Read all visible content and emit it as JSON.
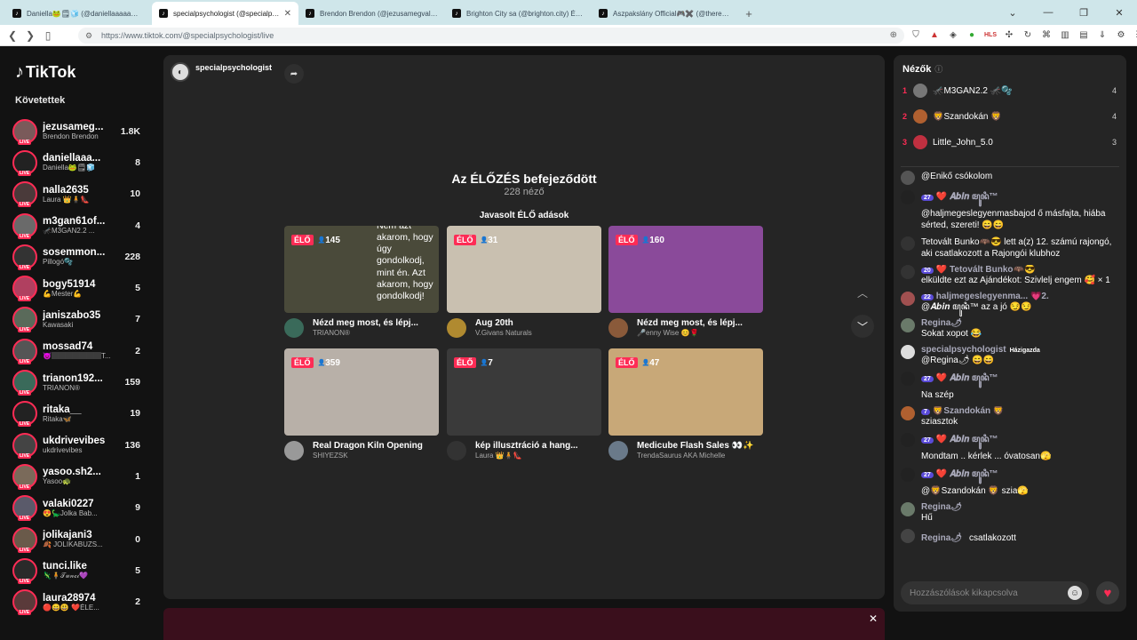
{
  "browser": {
    "tabs": [
      {
        "title": "Daniella🐸🗒🧊 (@daniellaaaaa…"
      },
      {
        "title": "specialpsychologist (@specialps…"
      },
      {
        "title": "Brendon Brendon (@jezusamegvalt…"
      },
      {
        "title": "Brighton City sa (@brighton.city) ÉLŐ"
      },
      {
        "title": "Aszpakslány Official🎮✖️ (@theresi…"
      }
    ],
    "url": "https://www.tiktok.com/@specialpsychologist/live",
    "new_tab": "+"
  },
  "sidebar": {
    "logo": "TikTok",
    "following_label": "Követettek",
    "live_tag": "LIVE",
    "items": [
      {
        "user": "jezusameg...",
        "display": "Brendon Brendon",
        "count": "1.8K",
        "color": "#7a5a5a"
      },
      {
        "user": "daniellaaa...",
        "display": "Daniella🐸🗒🧊",
        "count": "8",
        "color": "#222"
      },
      {
        "user": "nalla2635",
        "display": "Laura 👑🧍👠",
        "count": "10",
        "color": "#4a3a3a"
      },
      {
        "user": "m3gan61of...",
        "display": "🦟M3GAN2.2 ...",
        "count": "4",
        "color": "#6a6a6a"
      },
      {
        "user": "sosemmon...",
        "display": "Pillogó🫧",
        "count": "228",
        "color": "#333"
      },
      {
        "user": "bogy51914",
        "display": "💪Mester💪",
        "count": "5",
        "color": "#b04060"
      },
      {
        "user": "janiszabo35",
        "display": "Kawasaki",
        "count": "7",
        "color": "#5a6a5a"
      },
      {
        "user": "mossad74",
        "display": "😈🏽🏽🏽🏽🏽🏽🏽T...",
        "count": "2",
        "color": "#555"
      },
      {
        "user": "trianon192...",
        "display": "TRIANON®",
        "count": "159",
        "color": "#3a6a5a"
      },
      {
        "user": "ritaka__",
        "display": "Ritaka🦋",
        "count": "19",
        "color": "#222"
      },
      {
        "user": "ukdrivevibes",
        "display": "ukdrivevibes",
        "count": "136",
        "color": "#444"
      },
      {
        "user": "yasoo.sh2...",
        "display": "Yasoo🐢",
        "count": "1",
        "color": "#7a6a5a"
      },
      {
        "user": "valaki0227",
        "display": "😍🦕Jolka Bab...",
        "count": "9",
        "color": "#5a5a6a"
      },
      {
        "user": "jolikajani3",
        "display": "🍂 JOLIKABUZS...",
        "count": "0",
        "color": "#6a5a4a"
      },
      {
        "user": "tunci.like",
        "display": "🦎🧍𝒯𝓊𝓃𝒸𝒾💜",
        "count": "5",
        "color": "#2a2a2a"
      },
      {
        "user": "laura28974",
        "display": "🔴😄😃 ❤️ÉLE...",
        "count": "2",
        "color": "#5a3a3a"
      }
    ]
  },
  "main": {
    "host": "specialpsychologist",
    "ended_title": "Az ÉLŐZÉS befejeződött",
    "viewers": "228 néző",
    "suggested_label": "Javasolt ÉLŐ adások",
    "live_badge": "ÉLŐ",
    "cards": [
      {
        "viewers": "145",
        "title": "Nézd meg most, és lépj...",
        "sub": "TRIANON®",
        "bg": "#4a4a3a",
        "thumb_text": "Nem azt akarom, hogy úgy gondolkodj, mint én. Azt akarom, hogy gondolkodj!"
      },
      {
        "viewers": "31",
        "title": "Aug 20th",
        "sub": "V.Givans Naturals",
        "bg": "#c9c0b0",
        "thumb_text": ""
      },
      {
        "viewers": "160",
        "title": "Nézd meg most, és lépj...",
        "sub": "🎤enny Wise 😊🌹",
        "bg": "#8a4a9a",
        "thumb_text": ""
      },
      {
        "viewers": "359",
        "title": "Real Dragon Kiln Opening",
        "sub": "SHIYEZSK",
        "bg": "#b8b0a8",
        "thumb_text": ""
      },
      {
        "viewers": "7",
        "title": "kép illusztráció a hang...",
        "sub": "Laura 👑🧍👠",
        "bg": "#3a3a3a",
        "thumb_text": ""
      },
      {
        "viewers": "47",
        "title": "Medicube Flash Sales 👀✨",
        "sub": "TrendaSaurus AKA Michelle",
        "bg": "#c8a878",
        "thumb_text": ""
      }
    ]
  },
  "chat": {
    "title": "Nézők",
    "ranking": [
      {
        "rank": "1",
        "name": "🦟M3GAN2.2 🦟🫧",
        "score": "4",
        "color": "#777"
      },
      {
        "rank": "2",
        "name": "🦁Szandokán 🦁",
        "score": "4",
        "color": "#b06030"
      },
      {
        "rank": "3",
        "name": "Little_John_5.0",
        "score": "3",
        "color": "#c03040"
      }
    ],
    "messages": [
      {
        "name": "",
        "lvl": "",
        "text": "@Enikő csókolom",
        "color": "#555"
      },
      {
        "name": "❤️ 𝑨𝒃𝒊𝒏 ꦩꦸꦤꦶ™",
        "lvl": "27",
        "text": "@haljmegeslegyenmasbajod ő másfajta, hiába sérted, szereti! 😄😄",
        "color": "#222"
      },
      {
        "name": "",
        "lvl": "",
        "text": "Tetovált Bunko🦇😎 lett a(z) 12. számú rajongó, aki csatlakozott a Rajongói klubhoz",
        "color": "#333"
      },
      {
        "name": "❤️ Tetovált Bunko🦇😎",
        "lvl": "20",
        "text": "elküldte ezt az Ajándékot: Szivlelj engem 🥰 × 1",
        "color": "#333"
      },
      {
        "name": "haljmegeslegyenma... 💗2.",
        "lvl": "22",
        "text": "@𝑨𝒃𝒊𝒏 ꦩꦸꦤꦶ™ az a jó 😏😏",
        "color": "#a05050"
      },
      {
        "name": "Regina🌶",
        "lvl": "",
        "text": "Sokat xopot 😂",
        "color": "#6a7a6a"
      },
      {
        "name": "specialpsychologist",
        "lvl": "",
        "text": "@Regina🌶  😄😄",
        "color": "#ddd",
        "host_tag": "Házigazda"
      },
      {
        "name": "❤️ 𝑨𝒃𝒊𝒏 ꦩꦸꦤꦶ™",
        "lvl": "27",
        "text": "Na szép",
        "color": "#222"
      },
      {
        "name": "🦁Szandokán 🦁",
        "lvl": "7",
        "text": "sziasztok",
        "color": "#b06030"
      },
      {
        "name": "❤️ 𝑨𝒃𝒊𝒏 ꦩꦸꦤꦶ™",
        "lvl": "27",
        "text": "Mondtam .. kérlek ... óvatosan🫣",
        "color": "#222"
      },
      {
        "name": "❤️ 𝑨𝒃𝒊𝒏 ꦩꦸꦤꦶ™",
        "lvl": "27",
        "text": "@🦁Szandokán 🦁 szia🫣",
        "color": "#222"
      },
      {
        "name": "Regina🌶",
        "lvl": "",
        "text": "Hű",
        "color": "#6a7a6a"
      },
      {
        "name": "Regina🌶",
        "lvl": "",
        "text": "csatlakozott",
        "color": "#444",
        "inline": true
      }
    ],
    "input_placeholder": "Hozzászólások kikapcsolva"
  }
}
